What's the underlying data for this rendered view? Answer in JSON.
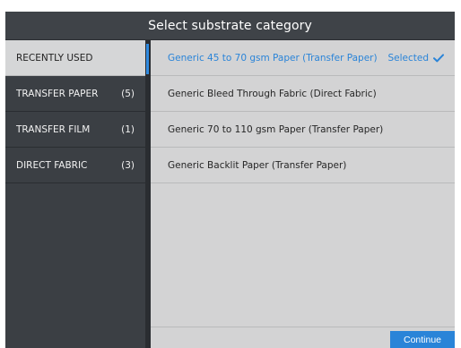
{
  "header": {
    "title": "Select substrate category"
  },
  "sidebar": {
    "items": [
      {
        "label": "RECENTLY USED",
        "count": "",
        "active": true
      },
      {
        "label": "TRANSFER PAPER",
        "count": "(5)",
        "active": false
      },
      {
        "label": "TRANSFER FILM",
        "count": "(1)",
        "active": false
      },
      {
        "label": "DIRECT FABRIC",
        "count": "(3)",
        "active": false
      }
    ]
  },
  "content": {
    "rows": [
      {
        "label": "Generic 45 to 70 gsm Paper (Transfer Paper)",
        "status": "Selected",
        "selected": true
      },
      {
        "label": "Generic Bleed Through Fabric (Direct Fabric)",
        "status": "",
        "selected": false
      },
      {
        "label": "Generic 70 to 110 gsm Paper (Transfer Paper)",
        "status": "",
        "selected": false
      },
      {
        "label": "Generic Backlit Paper (Transfer Paper)",
        "status": "",
        "selected": false
      }
    ]
  },
  "footer": {
    "continue_label": "Continue"
  },
  "colors": {
    "accent": "#2a84d8",
    "sidebar_bg": "#3b3f44",
    "content_bg": "#d3d3d4",
    "active_item_bg": "#d5d6d7"
  },
  "icons": {
    "selected": "check-icon"
  }
}
